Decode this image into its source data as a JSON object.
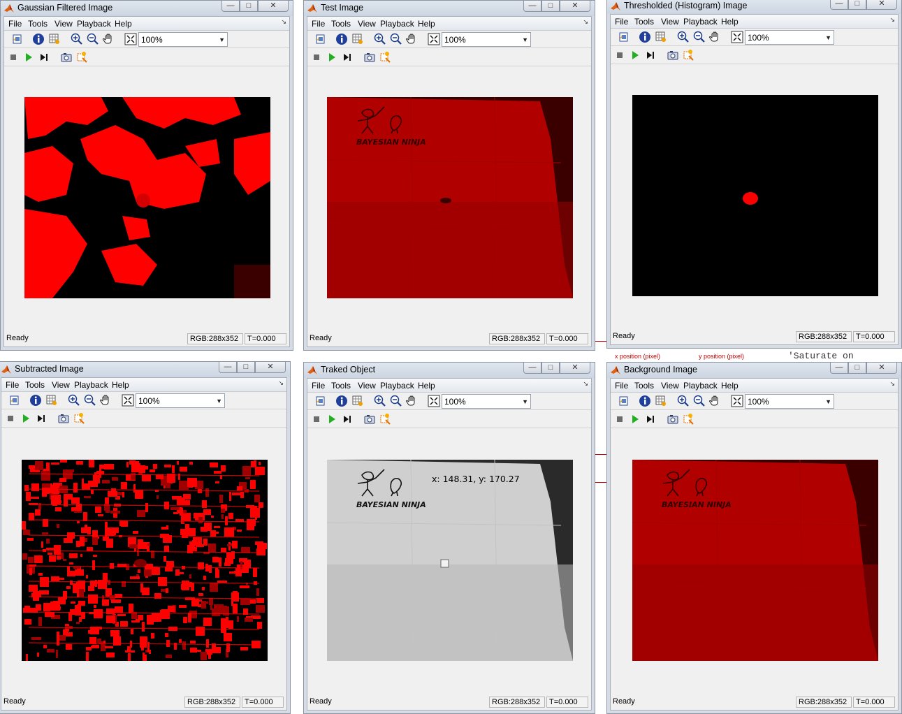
{
  "windows": [
    {
      "title": "Gaussian Filtered Image",
      "menu": [
        "File",
        "Tools",
        "View",
        "Playback",
        "Help"
      ],
      "zoom": "100%",
      "status": "Ready",
      "rgb": "RGB:288x352",
      "time": "T=0.000",
      "content": "gaussian"
    },
    {
      "title": "Test Image",
      "menu": [
        "File",
        "Tools",
        "View",
        "Playback",
        "Help"
      ],
      "zoom": "100%",
      "status": "Ready",
      "rgb": "RGB:288x352",
      "time": "T=0.000",
      "content": "test"
    },
    {
      "title": "Thresholded (Histogram) Image",
      "menu": [
        "File",
        "Tools",
        "View",
        "Playback",
        "Help"
      ],
      "zoom": "100%",
      "status": "Ready",
      "rgb": "RGB:288x352",
      "time": "T=0.000",
      "content": "threshold"
    },
    {
      "title": "Subtracted Image",
      "menu": [
        "File",
        "Tools",
        "View",
        "Playback",
        "Help"
      ],
      "zoom": "100%",
      "status": "Ready",
      "rgb": "RGB:288x352",
      "time": "T=0.000",
      "content": "subtracted"
    },
    {
      "title": "Traked Object",
      "menu": [
        "File",
        "Tools",
        "View",
        "Playback",
        "Help"
      ],
      "zoom": "100%",
      "status": "Ready",
      "rgb": "RGB:288x352",
      "time": "T=0.000",
      "content": "tracked",
      "overlay": "x: 148.31, y: 170.27"
    },
    {
      "title": "Background Image",
      "menu": [
        "File",
        "Tools",
        "View",
        "Playback",
        "Help"
      ],
      "zoom": "100%",
      "status": "Ready",
      "rgb": "RGB:288x352",
      "time": "T=0.000",
      "content": "background"
    }
  ],
  "logo_text": "BAYESIAN NINJA",
  "background": {
    "saturate_text": "'Saturate on",
    "xpos_label": "x position (pixel)",
    "ypos_label": "y position (pixel)"
  },
  "colors": {
    "red": "#ff0000",
    "dark_red": "#8b0000",
    "black": "#000000"
  }
}
